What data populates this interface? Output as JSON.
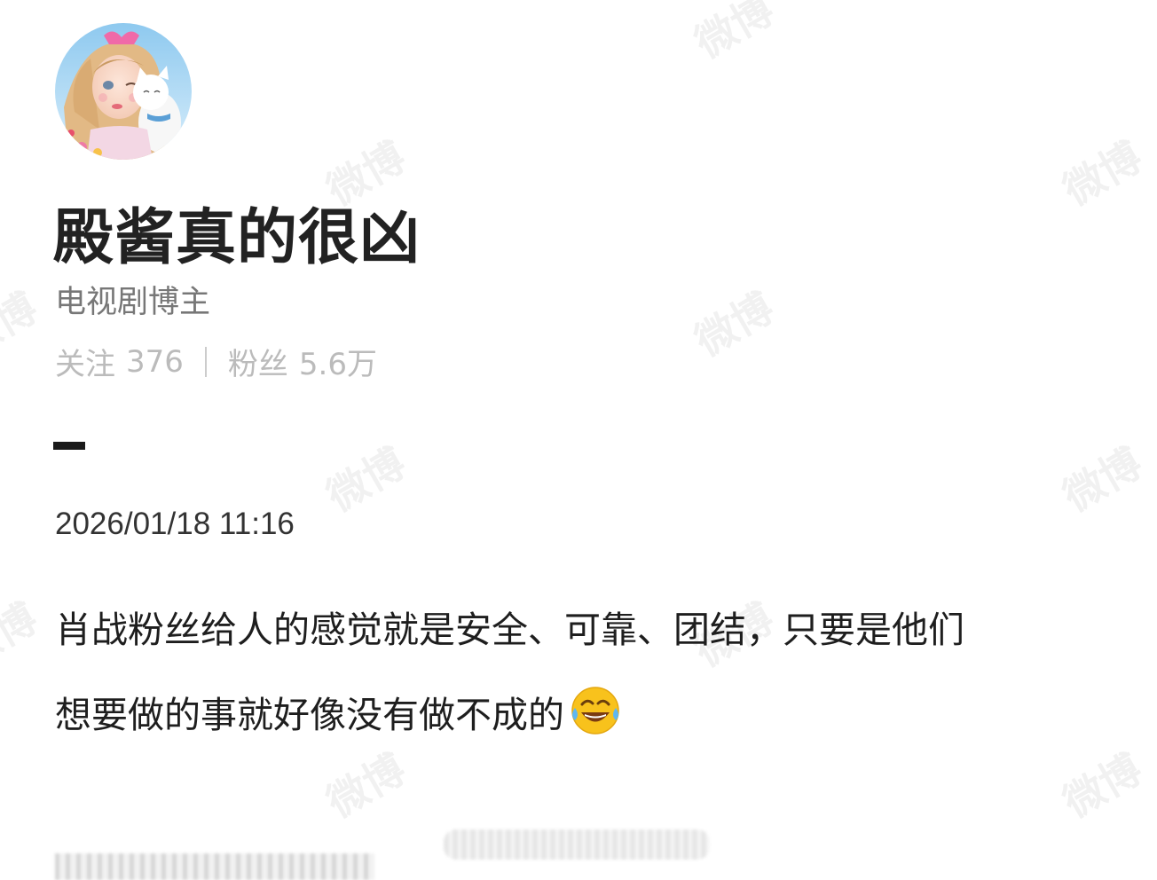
{
  "profile": {
    "name": "殿酱真的很凶",
    "role": "电视剧博主",
    "following_label": "关注",
    "following_count": "376",
    "followers_label": "粉丝",
    "followers_count": "5.6万"
  },
  "post": {
    "timestamp": "2026/01/18 11:16",
    "text_line1": "肖战粉丝给人的感觉就是安全、可靠、团结，只要是他们",
    "text_line2": "想要做的事就好像没有做不成的",
    "emoji_name": "laughing-tears-icon"
  },
  "watermark_text": "微博",
  "colors": {
    "name": "#222222",
    "role": "#777777",
    "stats": "#bbbbbb",
    "body_text": "#1e1e1e"
  }
}
